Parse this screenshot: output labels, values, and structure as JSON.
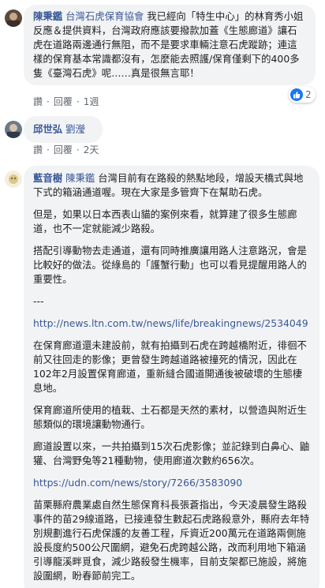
{
  "comments": [
    {
      "author": "陳秉鑑",
      "mention": "台灣石虎保育協會",
      "text": "我已經向「特生中心」的林育秀小姐反應＆提供資料，台灣政府應該要撥款加蓋《生態廊道》讓石虎在道路兩邊通行無阻，而不是要求車輛注意石虎蹤跡；連這樣的保育基本常識都沒有，怎麼能去照護/保育僅剩下的400多隻《臺灣石虎》呢……真是很無言耶！",
      "actions": {
        "like": "讚",
        "reply": "回覆",
        "time": "1週"
      },
      "reaction": {
        "icon": "like-thumb",
        "count": "2"
      }
    },
    {
      "author": "邱世弘",
      "mention": "",
      "text": "劉瀅",
      "actions": {
        "like": "讚",
        "reply": "回覆",
        "time": "2天"
      }
    },
    {
      "author": "藍音樹",
      "mention": "陳秉鑑",
      "paragraphs": [
        "台灣目前有在路殺的熱點地段，增設天橋式與地下式的箱涵通道喔。現在大家是多管齊下在幫助石虎。",
        "但是，如果以日本西表山貓的案例來看，就算建了很多生態廊道，也不一定就能減少路殺。",
        "搭配引導動物去走通道，還有同時推廣讓用路人注意路況，會是比較好的做法。從綠島的「護蟹行動」也可以看見提醒用路人的重要性。",
        "---",
        "http://news.ltn.com.tw/news/life/breakingnews/2534049",
        "在保育廊道還未建設前，就有拍攝到石虎在跨越橋附近，徘徊不前又往回走的影像；更曾發生跨越道路被撞死的情況，因此在102年2月設置保育廊道，重新縫合國道開通後被破壞的生態棲息地。",
        "保育廊道所使用的植栽、土石都是天然的素材，以營造與附近生態類似的環境讓動物通行。",
        "廊道設置以來，一共拍攝到15次石虎影像；並記錄到白鼻心、鼬獾、台灣野兔等21種動物，使用廊道次數約656次。",
        "https://udn.com/news/story/7266/3583090",
        "苗栗縣府農業處自然生態保育科長張蒼指出，今天凌晨發生路殺事件的苗29線道路，已接連發生數起石虎路殺意外，縣府去年特別規劃進行石虎保護的友善工程，斥資近200萬元在道路兩側施設長度約500公尺圍網，避免石虎跨越公路，改而利用地下箱涵引導龍溪畔覓食，減少路殺發生機率，目前支架都已施設，將施設圍網，盼春節前完工。"
      ]
    }
  ],
  "colors": {
    "link": "#385898",
    "bubble": "#f2f3f5",
    "like": "#1877f2"
  }
}
